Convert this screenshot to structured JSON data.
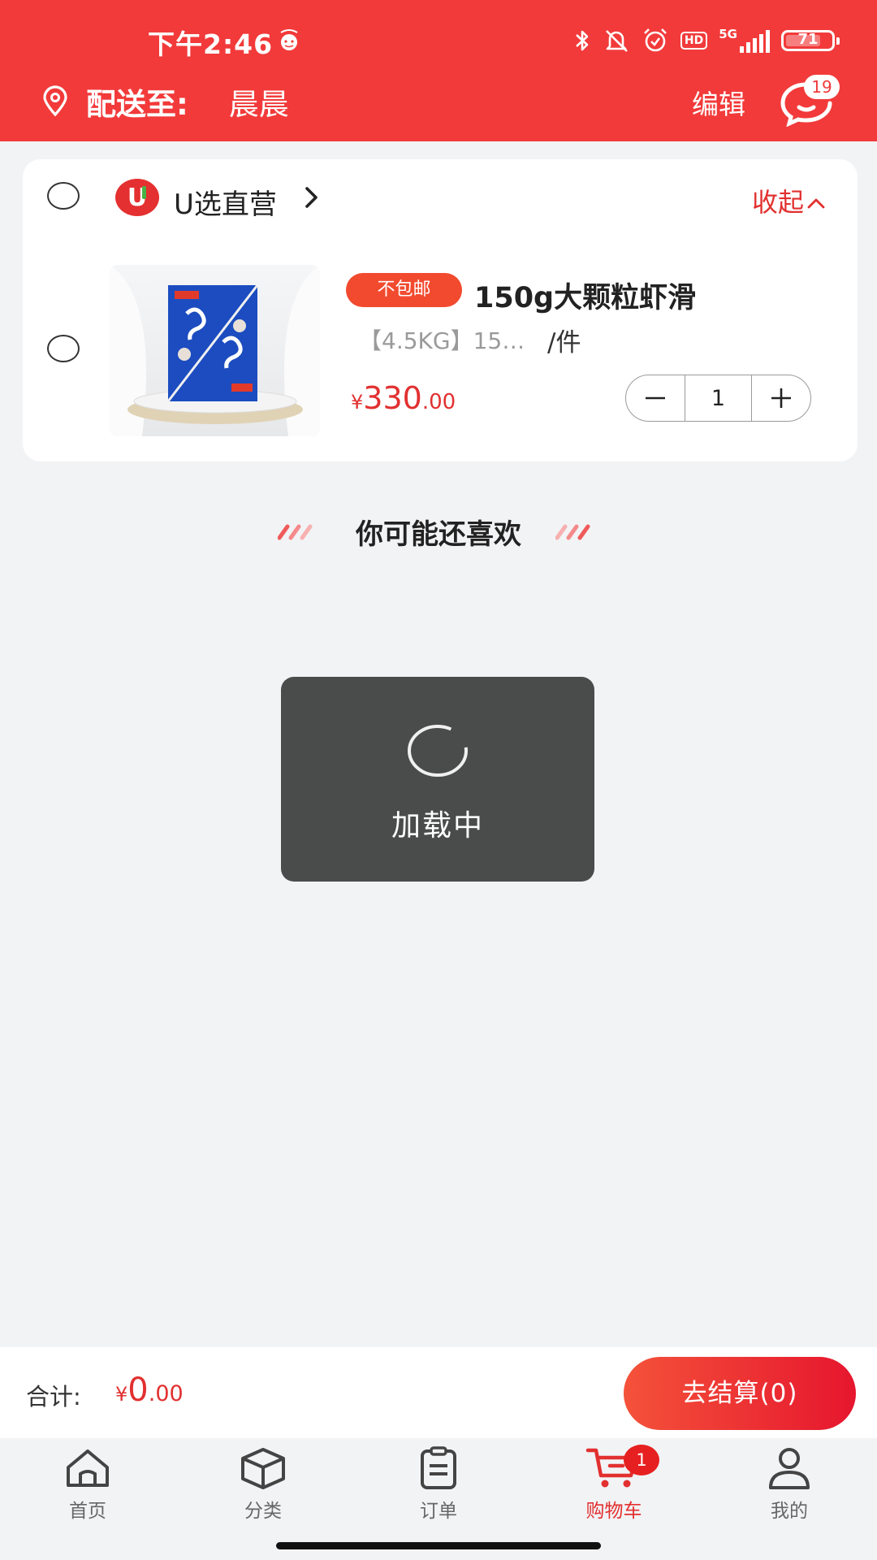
{
  "status_bar": {
    "time": "下午2:46",
    "battery": "71",
    "network": "5G",
    "hd": "HD",
    "icons": [
      "bluetooth-icon",
      "mute-bell-icon",
      "alarm-icon",
      "hd-icon",
      "signal-icon",
      "battery-icon"
    ]
  },
  "header": {
    "address_label": "配送至:",
    "address_name": "晨晨",
    "edit_label": "编辑",
    "message_badge": "19"
  },
  "shop": {
    "logo_text": "U",
    "name": "U选直营",
    "collapse_label": "收起",
    "item": {
      "tag": "不包邮",
      "title": "150g大颗粒虾滑",
      "spec": "【4.5KG】15…",
      "unit": "/件",
      "price_currency": "¥",
      "price_integer": "330",
      "price_decimal": ".00",
      "quantity": "1"
    }
  },
  "recommend": {
    "title": "你可能还喜欢"
  },
  "loading": {
    "text": "加载中"
  },
  "checkout": {
    "total_label": "合计:",
    "total_currency": "¥",
    "total_integer": "0",
    "total_decimal": ".00",
    "checkout_label": "去结算(0)"
  },
  "tabbar": {
    "tabs": [
      {
        "label": "首页",
        "icon": "home-icon"
      },
      {
        "label": "分类",
        "icon": "box-icon"
      },
      {
        "label": "订单",
        "icon": "clipboard-icon"
      },
      {
        "label": "购物车",
        "icon": "cart-icon",
        "active": true
      },
      {
        "label": "我的",
        "icon": "user-icon"
      }
    ],
    "cart_badge": "1"
  },
  "colors": {
    "brand_red": "#f23a3a",
    "price_red": "#e23030",
    "background": "#f2f3f5",
    "toast": "#4a4b4b"
  }
}
